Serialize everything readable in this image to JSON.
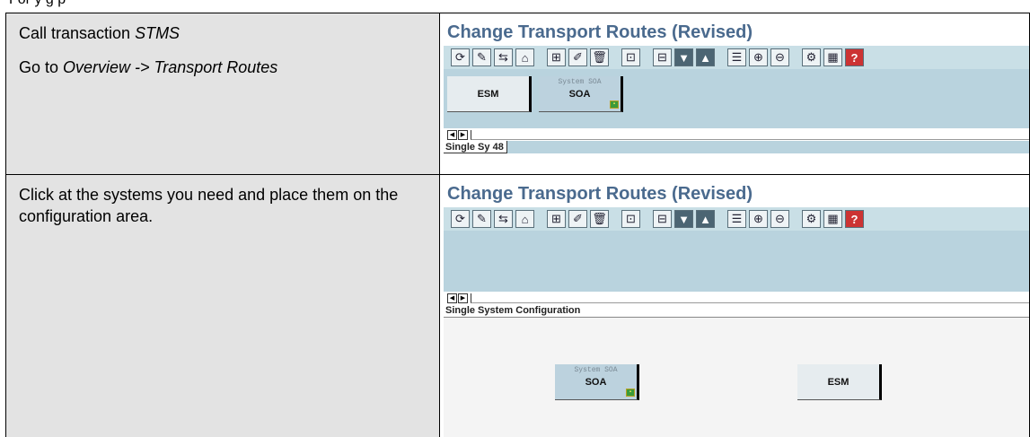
{
  "top_fragment": "For     y                                                                            g p",
  "steps": [
    {
      "instructions": [
        {
          "prefix": "Call transaction ",
          "emphasis": "STMS"
        },
        {
          "prefix": "Go to ",
          "emphasis": "Overview -> Transport Routes"
        }
      ],
      "screenshot": {
        "title": "Change Transport Routes (Revised)",
        "systems": [
          {
            "label": "ESM",
            "subtitle": ""
          },
          {
            "label": "SOA",
            "subtitle": "System SOA"
          }
        ],
        "status": "Single Sy 48"
      }
    },
    {
      "instructions": [
        {
          "prefix": "Click at the systems you need and place them on the configuration area.",
          "emphasis": ""
        }
      ],
      "screenshot": {
        "title": "Change Transport Routes (Revised)",
        "systems": [
          {
            "label": "SOA",
            "subtitle": "System SOA"
          },
          {
            "label": "ESM",
            "subtitle": ""
          }
        ],
        "status": "Single System Configuration"
      }
    }
  ],
  "toolbar_icons": [
    "refresh-icon",
    "edit-icon",
    "distribute-icon",
    "import-icon",
    "network-icon",
    "pencil-icon",
    "delete-icon",
    "fit-icon",
    "layout-icon",
    "arrow-down-icon",
    "arrow-up-icon",
    "legend-icon",
    "zoom-in-icon",
    "zoom-out-icon",
    "settings-icon",
    "table-icon",
    "help-icon"
  ],
  "colors": {
    "title": "#4a6a8e",
    "toolbar": "#c9dfe6",
    "canvas": "#b9d3de",
    "cell_bg": "#e3e3e3"
  }
}
